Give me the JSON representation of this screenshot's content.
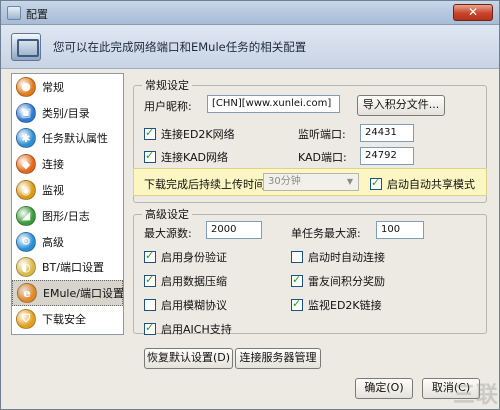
{
  "window": {
    "title": "配置",
    "close_glyph": "✕"
  },
  "header": {
    "text": "您可以在此完成网络端口和EMule任务的相关配置"
  },
  "sidebar": {
    "items": [
      {
        "label": "常规",
        "icon": "general-icon",
        "color": "#e07a1a",
        "glyph": "●",
        "selected": false
      },
      {
        "label": "类别/目录",
        "icon": "folder-icon",
        "color": "#2f7ad0",
        "glyph": "▣",
        "selected": false
      },
      {
        "label": "任务默认属性",
        "icon": "task-properties-icon",
        "color": "#2f8ed0",
        "glyph": "✱",
        "selected": false
      },
      {
        "label": "连接",
        "icon": "connection-icon",
        "color": "#e06a1a",
        "glyph": "◆",
        "selected": false
      },
      {
        "label": "监视",
        "icon": "monitor-icon",
        "color": "#d99a18",
        "glyph": "◉",
        "selected": false
      },
      {
        "label": "图形/日志",
        "icon": "graph-log-icon",
        "color": "#3a9b3a",
        "glyph": "◢",
        "selected": false
      },
      {
        "label": "高级",
        "icon": "advanced-icon",
        "color": "#2c8fd6",
        "glyph": "⚙",
        "selected": false
      },
      {
        "label": "BT/端口设置",
        "icon": "bt-port-icon",
        "color": "#d8b84a",
        "glyph": "◐",
        "selected": false
      },
      {
        "label": "EMule/端口设置",
        "icon": "emule-port-icon",
        "color": "#e08a2a",
        "glyph": "e",
        "selected": true
      },
      {
        "label": "下载安全",
        "icon": "download-security-icon",
        "color": "#e0a020",
        "glyph": "⛉",
        "selected": false
      }
    ]
  },
  "general": {
    "legend": "常规设定",
    "nickname_label": "用户昵称:",
    "nickname_value": "[CHN][www.xunlei.com]",
    "import_button": "导入积分文件...",
    "ed2k_checkbox": "连接ED2K网络",
    "ed2k_checked": true,
    "listen_port_label": "监听端口:",
    "listen_port_value": "24431",
    "kad_checkbox": "连接KAD网络",
    "kad_checked": true,
    "kad_port_label": "KAD端口:",
    "kad_port_value": "24792",
    "upload_time_label": "下载完成后持续上传时间:",
    "upload_time_value": "30分钟",
    "auto_share_checkbox": "启动自动共享模式",
    "auto_share_checked": true
  },
  "advanced": {
    "legend": "高级设定",
    "max_sources_label": "最大源数:",
    "max_sources_value": "2000",
    "task_max_sources_label": "单任务最大源:",
    "task_max_sources_value": "100",
    "checkboxes": [
      {
        "label": "启用身份验证",
        "checked": true
      },
      {
        "label": "启动时自动连接",
        "checked": false
      },
      {
        "label": "启用数据压缩",
        "checked": true
      },
      {
        "label": "雷友间积分奖励",
        "checked": true
      },
      {
        "label": "启用模糊协议",
        "checked": false
      },
      {
        "label": "监视ED2K链接",
        "checked": true
      },
      {
        "label": "启用AICH支持",
        "checked": true
      }
    ]
  },
  "buttons": {
    "restore_default": "恢复默认设置(D)",
    "server_manage": "连接服务器管理",
    "ok": "确定(O)",
    "cancel": "取消(C)"
  },
  "watermark": "三联"
}
